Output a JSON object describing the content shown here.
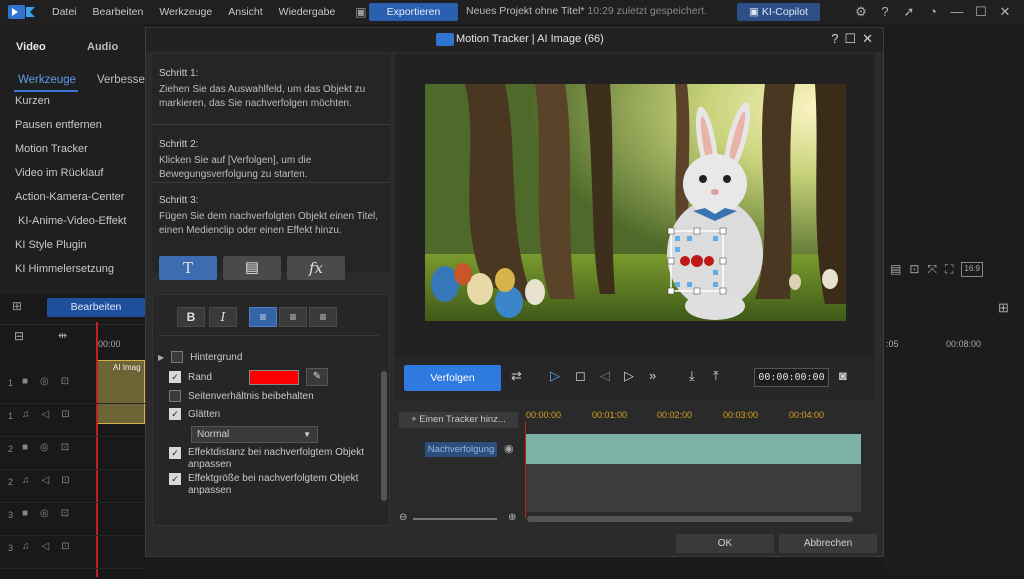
{
  "menubar": {
    "items": [
      "Datei",
      "Bearbeiten",
      "Werkzeuge",
      "Ansicht",
      "Wiedergabe"
    ],
    "export_label": "Exportieren",
    "project_title": "Neues Projekt ohne Titel*",
    "project_saved": "10:29 zuletzt gespeichert.",
    "copilot_label": "KI-Copilot"
  },
  "left_app": {
    "tab_video": "Video",
    "tab_audio": "Audio",
    "subtab_tools": "Werkzeuge",
    "subtab_improve": "Verbesser",
    "tools": [
      "Kurzen",
      "Pausen entfernen",
      "Motion Tracker",
      "Video im Rücklauf",
      "Action-Kamera-Center",
      "KI-Anime-Video-Effekt",
      "KI Style Plugin",
      "KI Himmelersetzung"
    ],
    "edit_button": "Bearbeiten",
    "ruler_start": "00:00",
    "clip_label": "AI Imag",
    "track_numbers": [
      "1",
      "1",
      "2",
      "2",
      "3",
      "3"
    ]
  },
  "right_app": {
    "ratio": "16:9",
    "ruler_05": ":05",
    "ruler_0800": "00:08:00"
  },
  "dialog": {
    "title": "Motion Tracker",
    "subtitle": "AI Image (66)",
    "help": "?",
    "steps": [
      {
        "label": "Schritt 1:",
        "text": "Ziehen Sie das Auswahlfeld, um das Objekt zu markieren, das Sie nachverfolgen möchten."
      },
      {
        "label": "Schritt 2:",
        "text": "Klicken Sie auf [Verfolgen], um die Bewegungsverfolgung zu starten."
      },
      {
        "label": "Schritt 3:",
        "text": "Fügen Sie dem nachverfolgten Objekt einen Titel, einen Medienclip oder einen Effekt hinzu."
      }
    ],
    "btn_title_glyph": "T",
    "btn_fx_glyph": "fx",
    "format": {
      "bold": "B",
      "italic": "I"
    },
    "props": {
      "background": "Hintergrund",
      "border": "Rand",
      "border_color": "#ff0000",
      "keep_ratio": "Seitenverhältnis beibehalten",
      "smooth": "Glätten",
      "smooth_value": "Normal",
      "effect_distance": "Effektdistanz bei nachverfolgtem Objekt anpassen",
      "effect_size": "Effektgröße bei nachverfolgtem Objekt anpassen"
    },
    "track_button": "Verfolgen",
    "timecode": "00:00:00:00",
    "add_tracker": "Einen Tracker hinz...",
    "ruler": [
      "00:00:00",
      "00:01:00",
      "00:02:00",
      "00:03:00",
      "00:04:00"
    ],
    "tracker_name": "Nachverfolgung",
    "ok": "OK",
    "cancel": "Abbrechen"
  }
}
